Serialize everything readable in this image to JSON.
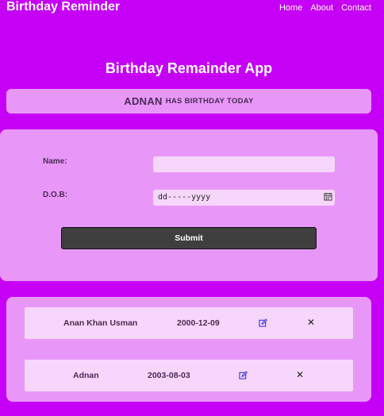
{
  "navbar": {
    "brand": "Birthday Reminder",
    "links": [
      "Home",
      "About",
      "Contact"
    ]
  },
  "app_title": "Birthday Remainder App",
  "banner": {
    "name": "ADNAN",
    "message": "HAS BIRTHDAY TODAY"
  },
  "form": {
    "name_label": "Name:",
    "name_value": "",
    "dob_label": "D.O.B:",
    "dob_placeholder": "dd-----yyyy",
    "submit_label": "Submit"
  },
  "birthdays": [
    {
      "name": "Anan Khan Usman",
      "dob": "2000-12-09",
      "edit_icon": "edit-icon",
      "delete_icon": "close-icon"
    },
    {
      "name": "Adnan",
      "dob": "2003-08-03",
      "edit_icon": "edit-icon",
      "delete_icon": "close-icon"
    }
  ],
  "colors": {
    "background": "#c600f7",
    "card": "#e897f8",
    "input": "#f7d6fc",
    "button": "#3f3f3f",
    "text": "#4a2a55",
    "edit_icon": "#2a2ad8"
  }
}
